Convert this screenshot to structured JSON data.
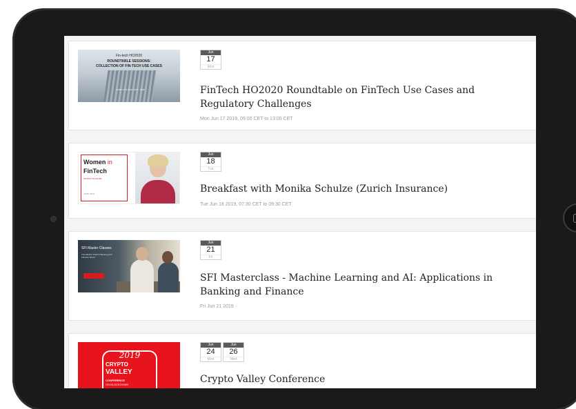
{
  "events": [
    {
      "title": "FinTech HO2020 Roundtable on FinTech Use Cases and Regulatory Challenges",
      "meta": "Mon Jun 17 2019, 09:00 CET to 13:00 CET",
      "dates": [
        {
          "month": "Jun",
          "day": "17",
          "weekday": "Mon"
        }
      ],
      "thumb": {
        "line1": "Fin-tech HO2020",
        "line2": "ROUNDTABLE SESSIONS:",
        "line3": "COLLECTION OF FIN-TECH USE CASES",
        "small": "JUNE 17TH 2019 | 9:00 - 13:00"
      }
    },
    {
      "title": "Breakfast with Monika Schulze (Zurich Insurance)",
      "meta": "Tue Jun 18 2019, 07:30 CET to 09:30 CET",
      "dates": [
        {
          "month": "Jun",
          "day": "18",
          "weekday": "Tue"
        }
      ],
      "thumb": {
        "word1": "Women",
        "word1b": "in",
        "word2": "FinTech",
        "small": "MONIKA SCHULZE",
        "foot": "JUNE 18TH"
      }
    },
    {
      "title": "SFI Masterclass - Machine Learning and AI: Applications in Banking and Finance",
      "meta": "Fri Jun 21 2019",
      "dates": [
        {
          "month": "Jun",
          "day": "21",
          "weekday": "Fri"
        }
      ],
      "thumb": {
        "heading": "SFI Master Classes",
        "sub": "The Modern Field of Banking and Finance Sector"
      }
    },
    {
      "title": "Crypto Valley Conference",
      "meta": "",
      "dates": [
        {
          "month": "Jun",
          "day": "24",
          "weekday": "Mon"
        },
        {
          "month": "Jun",
          "day": "26",
          "weekday": "Wed"
        }
      ],
      "thumb": {
        "year": "2019",
        "line1": "CRYPTO",
        "line2": "VALLEY",
        "line3": "CONFERENCE",
        "line4": "ON BLOCKCHAIN"
      }
    }
  ]
}
